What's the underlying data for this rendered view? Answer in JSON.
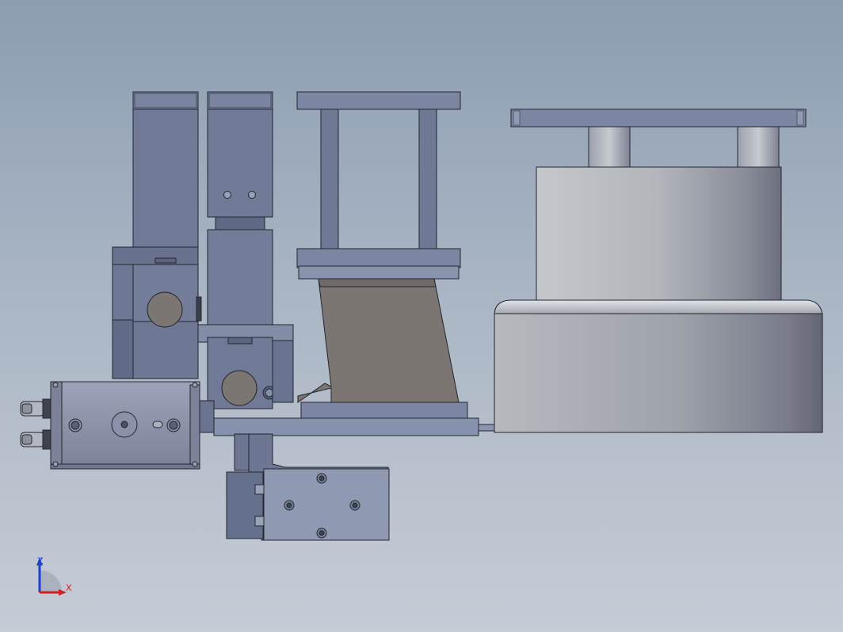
{
  "viewport": {
    "background_top": "#8c9db2",
    "background_bottom": "#c6ccd6"
  },
  "triad": {
    "z_label": "Z",
    "x_label": "X",
    "z_color": "#1f3fd0",
    "x_color": "#d02020"
  },
  "colors": {
    "part_blue": "#727c99",
    "part_dark": "#5b6480",
    "part_light": "#8b95b0",
    "casting": "#7b7672",
    "base_gray": "#a2a6ae",
    "cylinder_silver": "#b6babf",
    "outline": "#23262d"
  }
}
